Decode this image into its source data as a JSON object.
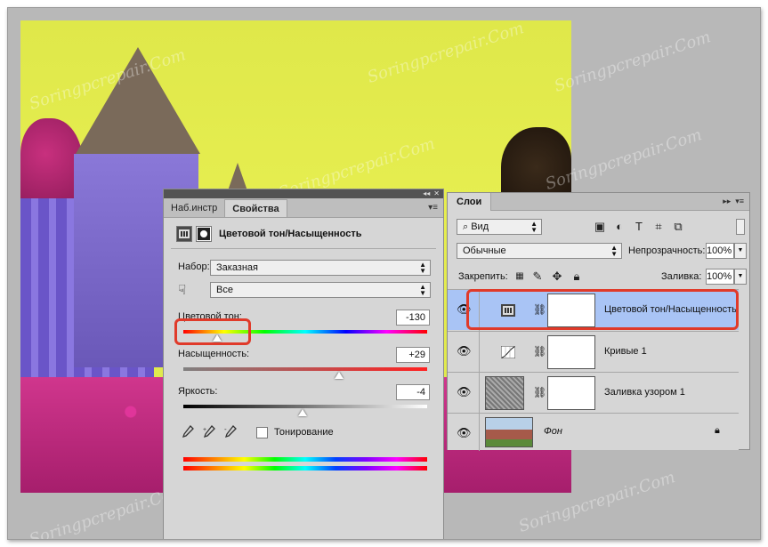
{
  "colors": {
    "highlight": "#e03a2a",
    "selected_layer": "#a9c4f5",
    "panel_bg": "#d6d6d6"
  },
  "watermark": "Soringpcrepair.Com",
  "properties_panel": {
    "tabs": [
      "Наб.инстр",
      "Свойства"
    ],
    "active_tab": 1,
    "adjustment_title": "Цветовой тон/Насыщенность",
    "preset_label": "Набор:",
    "preset_value": "Заказная",
    "channel_value": "Все",
    "hue": {
      "label": "Цветовой тон:",
      "value": "-130",
      "fraction": 0.14
    },
    "saturation": {
      "label": "Насыщенность:",
      "value": "+29",
      "fraction": 0.64
    },
    "brightness": {
      "label": "Яркость:",
      "value": "-4",
      "fraction": 0.49
    },
    "colorize_label": "Тонирование",
    "icons": {
      "collapse": "double-chevron-icon",
      "close": "close-icon",
      "menu": "panel-menu-icon",
      "adjustment": "hue-saturation-icon",
      "mask": "mask-icon",
      "hand": "target-adjust-hand-icon",
      "eyedroppers": [
        "eyedropper-icon",
        "eyedropper-plus-icon",
        "eyedropper-minus-icon"
      ]
    }
  },
  "layers_panel": {
    "tab_label": "Слои",
    "filter_kind": "Вид",
    "blend_mode": "Обычные",
    "opacity_label": "Непрозрачность:",
    "opacity_value": "100%",
    "lock_label": "Закрепить:",
    "fill_label": "Заливка:",
    "fill_value": "100%",
    "layers": [
      {
        "name": "Цветовой тон/Насыщенность",
        "selected": true,
        "icon": "hue-saturation-icon"
      },
      {
        "name": "Кривые 1",
        "selected": false,
        "icon": "curves-icon"
      },
      {
        "name": "Заливка узором 1",
        "selected": false,
        "icon": "pattern-fill-icon"
      },
      {
        "name": "Фон",
        "selected": false,
        "icon": "background-image",
        "locked": true
      }
    ]
  }
}
